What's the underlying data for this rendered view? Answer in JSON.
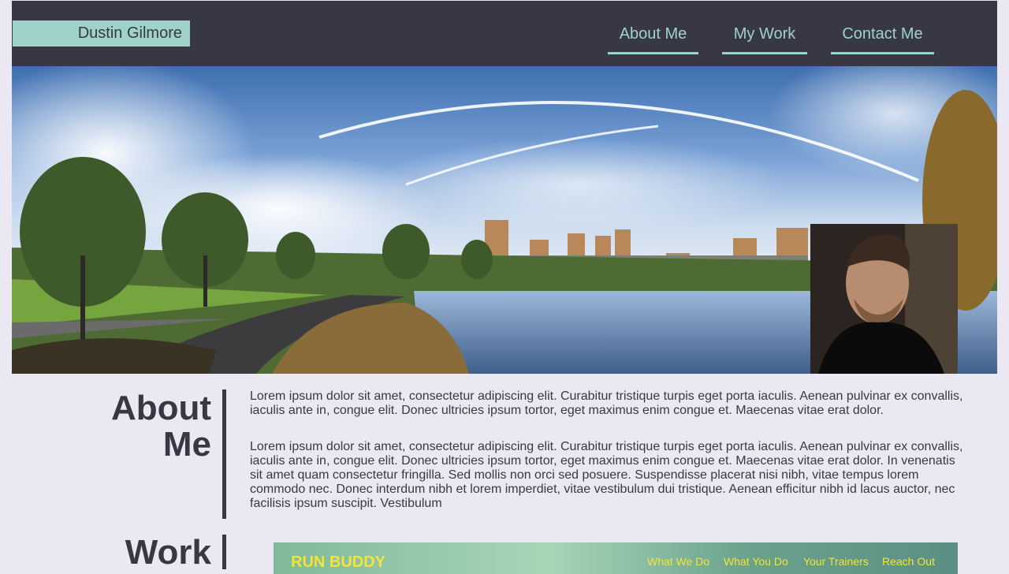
{
  "header": {
    "logo": "Dustin Gilmore",
    "nav": [
      {
        "label": "About Me"
      },
      {
        "label": "My Work"
      },
      {
        "label": "Contact Me"
      }
    ]
  },
  "about": {
    "title_line1": "About",
    "title_line2": "Me",
    "paragraph1": "Lorem ipsum dolor sit amet, consectetur adipiscing elit. Curabitur tristique turpis eget porta iaculis. Aenean pulvinar ex convallis, iaculis ante in, congue elit. Donec ultricies ipsum tortor, eget maximus enim congue et. Maecenas vitae erat dolor.",
    "paragraph2": "Lorem ipsum dolor sit amet, consectetur adipiscing elit. Curabitur tristique turpis eget porta iaculis. Aenean pulvinar ex convallis, iaculis ante in, congue elit. Donec ultricies ipsum tortor, eget maximus enim congue et. Maecenas vitae erat dolor. In venenatis sit amet quam consectetur fringilla. Sed mollis non orci sed posuere. Suspendisse placerat nisi nibh, vitae tempus lorem commodo nec. Donec interdum nibh et lorem imperdiet, vitae vestibulum dui tristique. Aenean efficitur nibh id lacus auctor, nec facilisis ipsum suscipit. Vestibulum"
  },
  "work": {
    "title": "Work",
    "project": {
      "brand": "RUN BUDDY",
      "nav": [
        "What We Do",
        "What You Do",
        "Your Trainers",
        "Reach Out"
      ]
    }
  },
  "colors": {
    "accent": "#9fd2cb",
    "dark": "#383844",
    "background": "#ebe8f3"
  }
}
